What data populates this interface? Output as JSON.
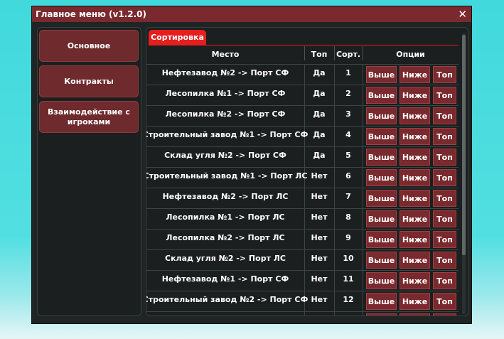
{
  "window": {
    "title": "Главное меню (v1.2.0)",
    "close_glyph": "✕"
  },
  "sidebar": {
    "items": [
      {
        "label": "Основное"
      },
      {
        "label": "Контракты"
      },
      {
        "label": "Взаимодействие с игроками"
      }
    ]
  },
  "tabs": [
    {
      "label": "Сортировка",
      "active": true
    }
  ],
  "table": {
    "headers": {
      "place": "Место",
      "top": "Топ",
      "sort": "Сорт.",
      "options": "Опции"
    },
    "button_labels": {
      "up": "Выше",
      "down": "Ниже",
      "top": "Топ"
    },
    "rows": [
      {
        "place": "Нефтезавод №2 -> Порт СФ",
        "top": "Да",
        "sort": "1"
      },
      {
        "place": "Лесопилка №1 -> Порт СФ",
        "top": "Да",
        "sort": "2"
      },
      {
        "place": "Лесопилка №2 -> Порт СФ",
        "top": "Да",
        "sort": "3"
      },
      {
        "place": "Строительный завод №1 -> Порт СФ",
        "top": "Да",
        "sort": "4"
      },
      {
        "place": "Склад угля №2 -> Порт СФ",
        "top": "Да",
        "sort": "5"
      },
      {
        "place": "Строительный завод №1 -> Порт ЛС",
        "top": "Нет",
        "sort": "6"
      },
      {
        "place": "Нефтезавод №2 -> Порт ЛС",
        "top": "Нет",
        "sort": "7"
      },
      {
        "place": "Лесопилка №1 -> Порт ЛС",
        "top": "Нет",
        "sort": "8"
      },
      {
        "place": "Лесопилка №2 -> Порт ЛС",
        "top": "Нет",
        "sort": "9"
      },
      {
        "place": "Склад угля №2 -> Порт ЛС",
        "top": "Нет",
        "sort": "10"
      },
      {
        "place": "Нефтезавод №1 -> Порт СФ",
        "top": "Нет",
        "sort": "11"
      },
      {
        "place": "Строительный завод №2 -> Порт СФ",
        "top": "Нет",
        "sort": "12"
      }
    ]
  },
  "colors": {
    "accent": "#e51e1e",
    "button": "#7a2a2e",
    "window_bg": "#1f2424",
    "background": "#41d9dc"
  },
  "icons": {
    "close": "close-icon"
  }
}
